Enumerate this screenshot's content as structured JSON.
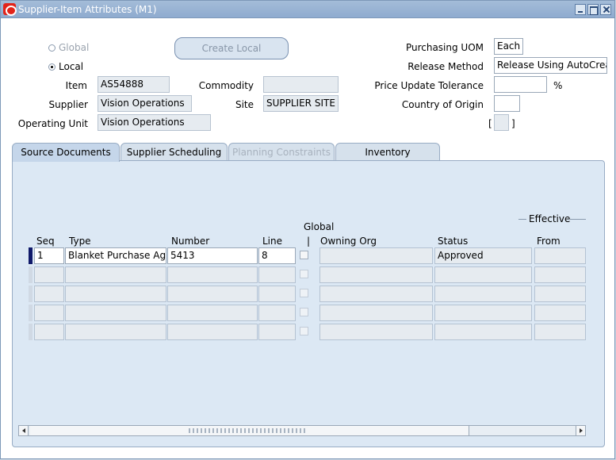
{
  "window": {
    "title": "Supplier-Item Attributes (M1)"
  },
  "scope": {
    "global_label": "Global",
    "local_label": "Local",
    "selected": "Local"
  },
  "create_local_label": "Create Local",
  "item": {
    "label": "Item",
    "value": "AS54888"
  },
  "commodity": {
    "label": "Commodity",
    "value": ""
  },
  "supplier": {
    "label": "Supplier",
    "value": "Vision Operations"
  },
  "site": {
    "label": "Site",
    "value": "SUPPLIER SITE"
  },
  "operating_unit": {
    "label": "Operating Unit",
    "value": "Vision Operations"
  },
  "purchasing_uom": {
    "label": "Purchasing UOM",
    "value": "Each"
  },
  "release_method": {
    "label": "Release Method",
    "value": "Release Using AutoCreate"
  },
  "price_tolerance": {
    "label": "Price Update Tolerance",
    "value": "",
    "unit": "%"
  },
  "country": {
    "label": "Country of Origin",
    "value": ""
  },
  "flex_field": {
    "open": "[",
    "close": "]"
  },
  "tabs": [
    {
      "label": "Source Documents",
      "state": "active"
    },
    {
      "label": "Supplier Scheduling",
      "state": "normal"
    },
    {
      "label": "Planning Constraints",
      "state": "disabled"
    },
    {
      "label": "Inventory",
      "state": "normal"
    }
  ],
  "grid": {
    "group_global": "Global",
    "group_global_sep": "|",
    "group_effective": "Effective",
    "columns": {
      "seq": "Seq",
      "type": "Type",
      "number": "Number",
      "line": "Line",
      "owning_org": "Owning Org",
      "status": "Status",
      "from": "From"
    },
    "rows": [
      {
        "seq": "1",
        "type": "Blanket Purchase Agreement",
        "number": "5413",
        "line": "8",
        "owning_org": "",
        "status": "Approved",
        "from": ""
      },
      {
        "seq": "",
        "type": "",
        "number": "",
        "line": "",
        "owning_org": "",
        "status": "",
        "from": ""
      },
      {
        "seq": "",
        "type": "",
        "number": "",
        "line": "",
        "owning_org": "",
        "status": "",
        "from": ""
      },
      {
        "seq": "",
        "type": "",
        "number": "",
        "line": "",
        "owning_org": "",
        "status": "",
        "from": ""
      },
      {
        "seq": "",
        "type": "",
        "number": "",
        "line": "",
        "owning_org": "",
        "status": "",
        "from": ""
      }
    ]
  },
  "colors": {
    "titlebar": "#8fabcf",
    "panel": "#dce8f4",
    "current_record": "#101a6a"
  }
}
